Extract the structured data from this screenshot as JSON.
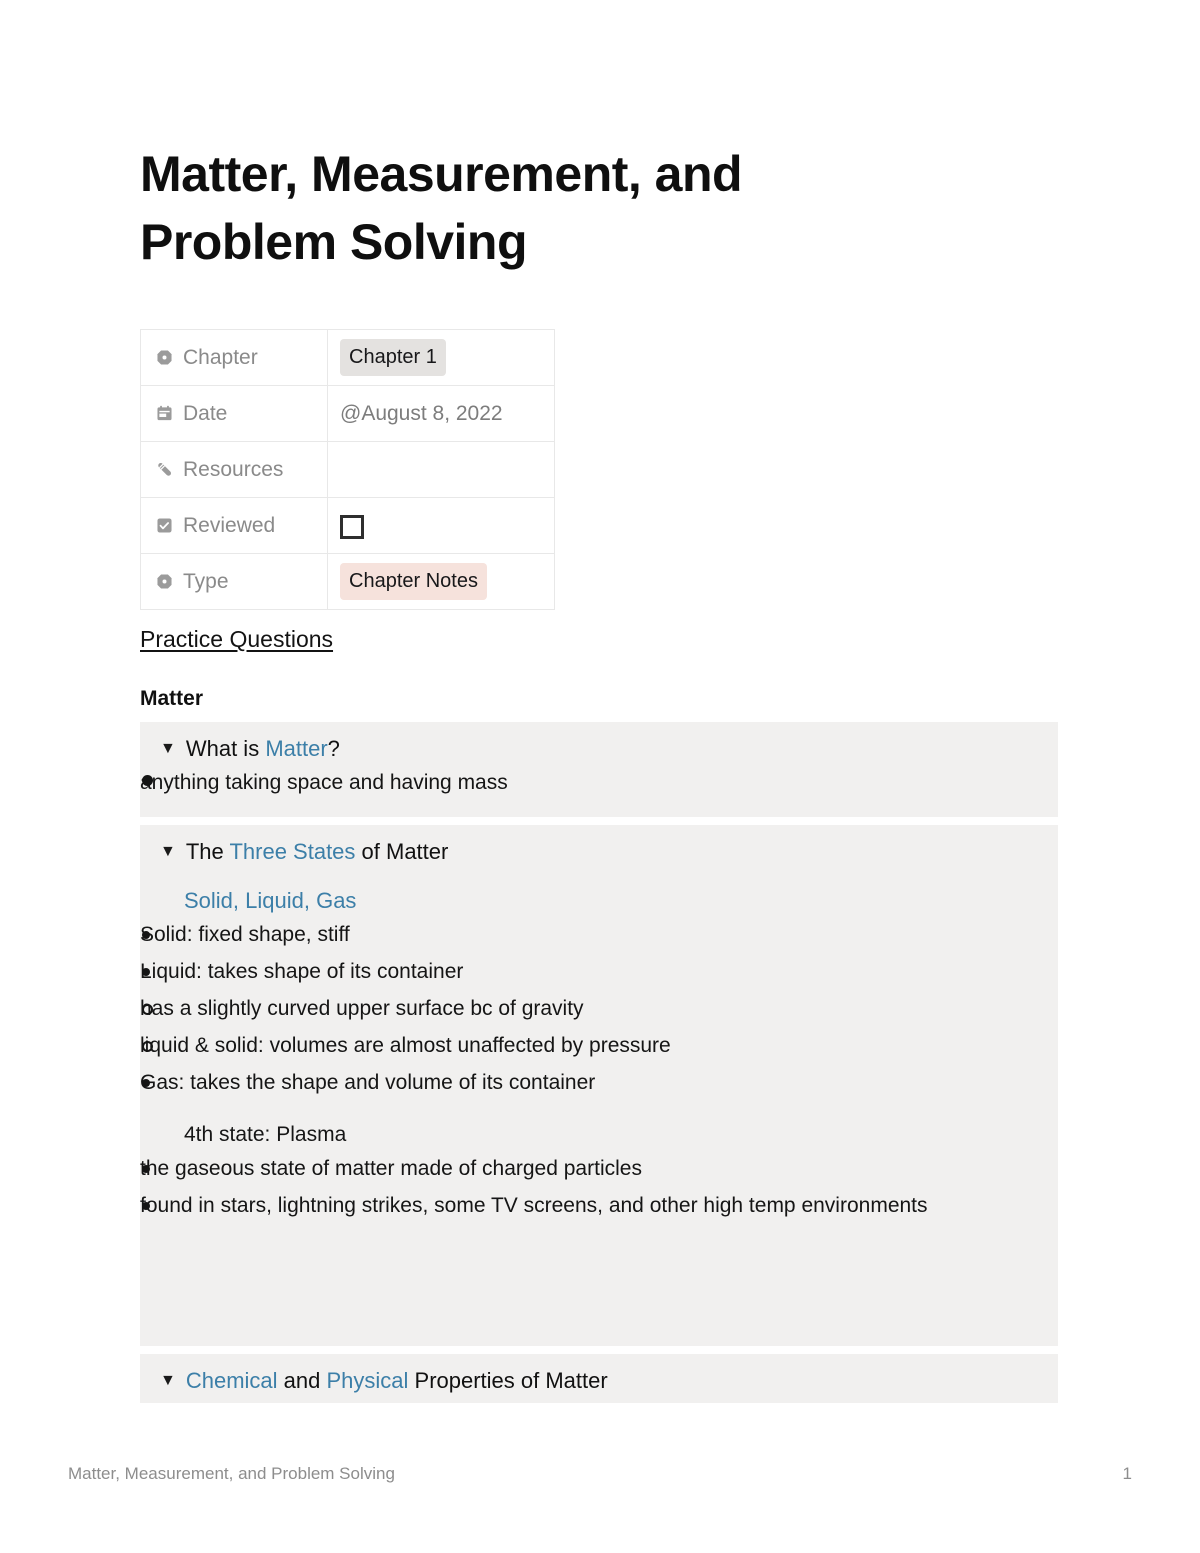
{
  "document": {
    "title": "Matter, Measurement, and\nProblem Solving",
    "footer_left": "Matter, Measurement, and Problem Solving",
    "footer_page": "1"
  },
  "colors": {
    "accent_blue": "#3c7fa8",
    "toggle_background": "#f1f0ef",
    "tag_gray": "#e4e2e0",
    "tag_pink": "#f6e2dc",
    "table_border": "#e8e8e8",
    "muted_text": "#8a8a8a"
  },
  "properties": [
    {
      "icon": "select-octagon-icon",
      "label": "Chapter",
      "value": "Chapter 1",
      "value_kind": "tag-gray"
    },
    {
      "icon": "calendar-icon",
      "label": "Date",
      "value": "@August 8, 2022",
      "value_kind": "plain"
    },
    {
      "icon": "paperclip-icon",
      "label": "Resources",
      "value": "",
      "value_kind": "plain"
    },
    {
      "icon": "checkbox-icon",
      "label": "Reviewed",
      "value": "",
      "value_kind": "checkbox-unchecked"
    },
    {
      "icon": "select-octagon-icon",
      "label": "Type",
      "value": "Chapter Notes",
      "value_kind": "tag-pink"
    }
  ],
  "headings": {
    "practice_questions": "Practice Questions",
    "matter": "Matter"
  },
  "toggles": {
    "what_is_matter": {
      "marker": "▼",
      "title_pre": "What is ",
      "title_link": "Matter",
      "title_post": "?",
      "bullets": [
        "anything taking space and having mass"
      ]
    },
    "three_states": {
      "marker": "▼",
      "title_pre": "The ",
      "title_link": "Three States",
      "title_post": " of Matter",
      "subtitle": "Solid, Liquid, Gas",
      "bullets": [
        "Solid: fixed shape, stiff",
        "Liquid: takes shape of its container",
        "Gas: takes the shape and volume of its container"
      ],
      "liquid_subbullets": [
        "has a slightly curved upper surface bc of gravity",
        "liquid & solid: volumes are almost unaffected by pressure"
      ],
      "fourth_state_label": "4th state: Plasma",
      "plasma_bullets": [
        "the gaseous state of matter made of charged particles",
        "found in stars, lightning strikes, some TV screens, and other high temp environments"
      ]
    },
    "chemical_physical": {
      "marker": "▼",
      "title_link_a": "Chemical",
      "title_mid": " and ",
      "title_link_b": "Physical",
      "title_post": " Properties of Matter"
    }
  }
}
